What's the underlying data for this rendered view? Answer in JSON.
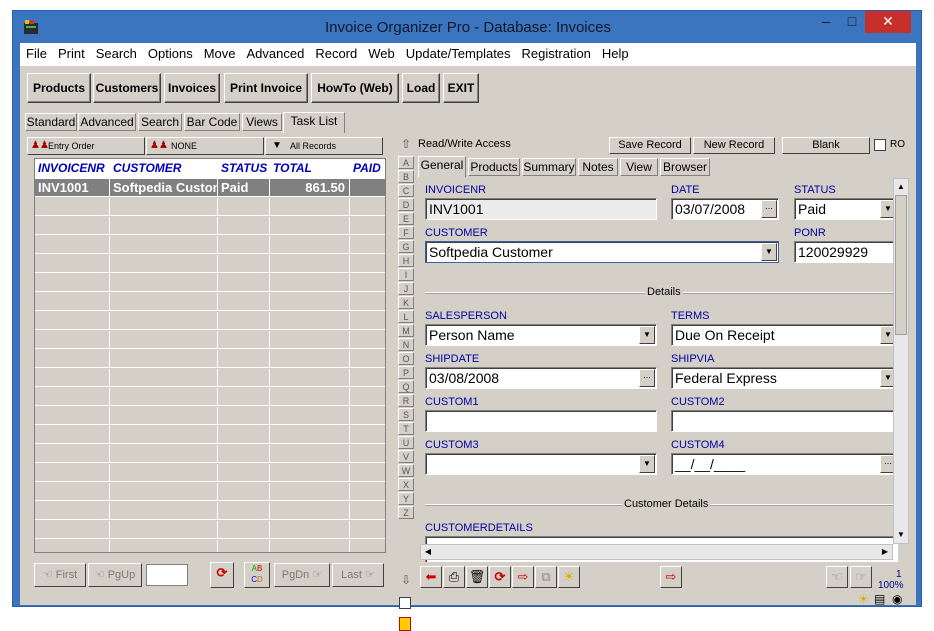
{
  "window": {
    "title": "Invoice Organizer Pro - Database: Invoices"
  },
  "menu": [
    "File",
    "Print",
    "Search",
    "Options",
    "Move",
    "Advanced",
    "Record",
    "Web",
    "Update/Templates",
    "Registration",
    "Help"
  ],
  "toolbar": [
    "Products",
    "Customers",
    "Invoices",
    "Print Invoice",
    "HowTo (Web)",
    "Load",
    "EXIT"
  ],
  "left_tabs": [
    "Standard",
    "Advanced",
    "Search",
    "Bar Code",
    "Views",
    "Task List"
  ],
  "left_header": {
    "order": "Entry Order",
    "filter": "NONE",
    "records": "All Records"
  },
  "grid": {
    "columns": [
      "INVOICENR",
      "CUSTOMER",
      "STATUS",
      "TOTAL",
      "PAID"
    ],
    "rows": [
      [
        "INV1001",
        "Softpedia Custon",
        "Paid",
        "861.50",
        ""
      ]
    ]
  },
  "nav": {
    "first": "First",
    "pgup": "PgUp",
    "pgdn": "PgDn",
    "last": "Last"
  },
  "alphabet": [
    "A",
    "B",
    "C",
    "D",
    "E",
    "F",
    "G",
    "H",
    "I",
    "J",
    "K",
    "L",
    "M",
    "N",
    "O",
    "P",
    "Q",
    "R",
    "S",
    "T",
    "U",
    "V",
    "W",
    "X",
    "Y",
    "Z"
  ],
  "right_header": {
    "access": "Read/Write Access",
    "save": "Save Record",
    "new": "New Record",
    "blank": "Blank",
    "ro": "RO"
  },
  "right_tabs": [
    "General",
    "Products",
    "Summary",
    "Notes",
    "View",
    "Browser"
  ],
  "form": {
    "invoicenr_label": "INVOICENR",
    "invoicenr": "INV1001",
    "date_label": "DATE",
    "date": "03/07/2008",
    "status_label": "STATUS",
    "status": "Paid",
    "customer_label": "CUSTOMER",
    "customer": "Softpedia Customer",
    "ponr_label": "PONR",
    "ponr": "120029929",
    "details_title": "Details",
    "salesperson_label": "SALESPERSON",
    "salesperson": "Person Name",
    "terms_label": "TERMS",
    "terms": "Due On Receipt",
    "shipdate_label": "SHIPDATE",
    "shipdate": "03/08/2008",
    "shipvia_label": "SHIPVIA",
    "shipvia": "Federal Express",
    "custom1_label": "CUSTOM1",
    "custom1": "",
    "custom2_label": "CUSTOM2",
    "custom2": "",
    "custom3_label": "CUSTOM3",
    "custom3": "",
    "custom4_label": "CUSTOM4",
    "custom4": "__/__/____",
    "customer_details_title": "Customer Details",
    "customerdetails_label": "CUSTOMERDETAILS"
  },
  "status": {
    "page": "1",
    "zoom": "100%"
  },
  "colors": {
    "title_bar": "#3b75c0",
    "close": "#c7302a",
    "label_blue": "#0000a0",
    "selected_row": "#808080"
  }
}
